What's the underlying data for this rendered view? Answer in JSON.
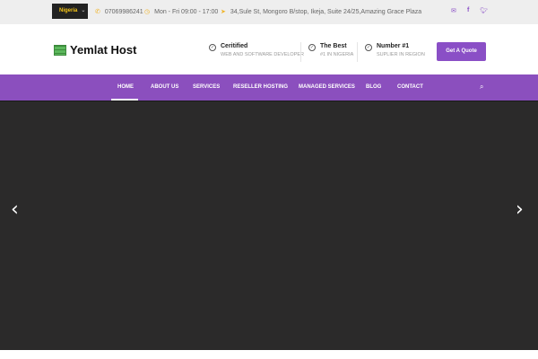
{
  "topbar": {
    "language": "Nigeria",
    "phone": "07069986241",
    "hours": "Mon - Fri 09:00 - 17:00",
    "address": "34,Sule St, Mongoro B/stop, Ikeja, Suite 24/25,Amazing Grace Plaza"
  },
  "logo": {
    "text": "Yemlat Host"
  },
  "features": [
    {
      "title": "Ceritified",
      "subtitle": "WEB AND SOFTWARE DEVELOPER"
    },
    {
      "title": "The Best",
      "subtitle": "#1 IN NIGERIA"
    },
    {
      "title": "Number #1",
      "subtitle": "SUPLIER IN REGION"
    }
  ],
  "quote_button": "Get A Quote",
  "nav": [
    "HOME",
    "ABOUT US",
    "SERVICES",
    "RESELLER HOSTING",
    "MANAGED SERVICES",
    "BLOG",
    "CONTACT"
  ],
  "colors": {
    "accent": "#8b4fbe",
    "hero": "#2b2a2a"
  }
}
